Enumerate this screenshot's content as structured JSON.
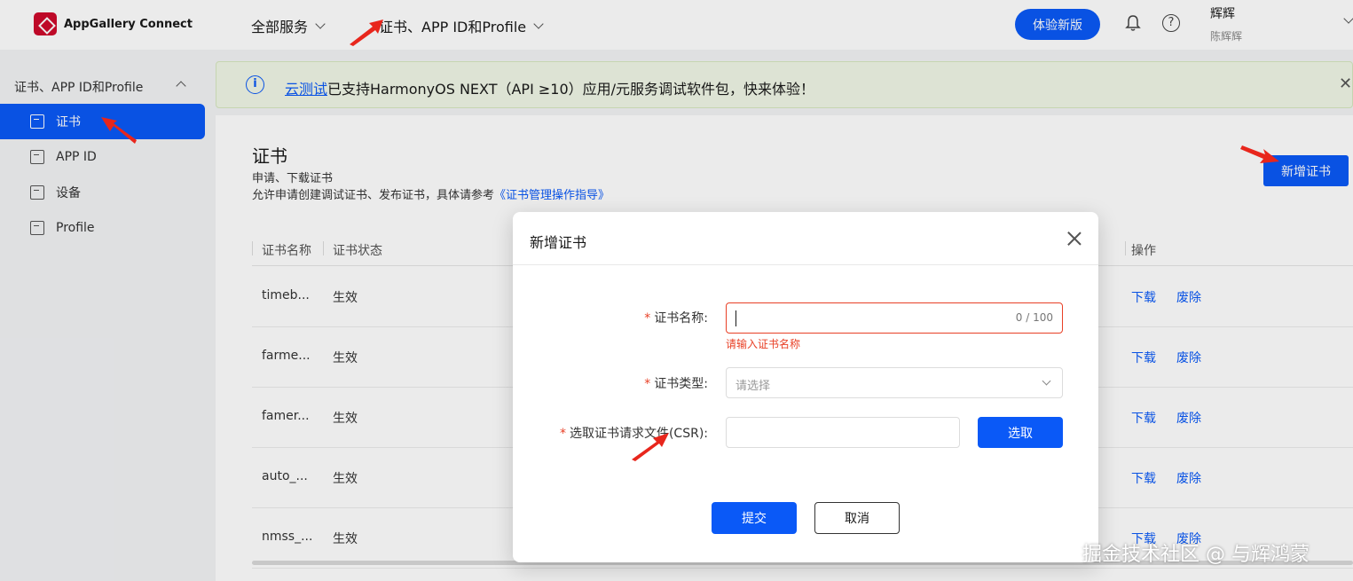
{
  "header": {
    "logo_text": "AppGallery Connect",
    "nav": [
      "全部服务",
      "证书、APP ID和Profile"
    ],
    "try_new_button": "体验新版",
    "user_name": "辉辉",
    "user_sub": "陈辉辉"
  },
  "sidebar": {
    "section_title": "证书、APP ID和Profile",
    "items": [
      {
        "label": "证书",
        "active": true
      },
      {
        "label": "APP ID",
        "active": false
      },
      {
        "label": "设备",
        "active": false
      },
      {
        "label": "Profile",
        "active": false
      }
    ]
  },
  "banner": {
    "link": "云测试",
    "text": "已支持HarmonyOS NEXT（API ≥10）应用/元服务调试软件包，快来体验！",
    "close": "✕"
  },
  "page": {
    "title": "证书",
    "subtitle": "申请、下载证书",
    "desc_prefix": "允许申请创建调试证书、发布证书，具体请参考",
    "desc_link": "《证书管理操作指导》",
    "add_button": "新增证书"
  },
  "table": {
    "headers": {
      "name": "证书名称",
      "status": "证书状态",
      "actions": "操作"
    },
    "rows": [
      {
        "name": "timeb...",
        "status": "生效",
        "download": "下载",
        "revoke": "废除"
      },
      {
        "name": "farme...",
        "status": "生效",
        "download": "下载",
        "revoke": "废除"
      },
      {
        "name": "famer...",
        "status": "生效",
        "download": "下载",
        "revoke": "废除"
      },
      {
        "name": "auto_...",
        "status": "生效",
        "download": "下载",
        "revoke": "废除"
      },
      {
        "name": "nmss_...",
        "status": "生效",
        "download": "下载",
        "revoke": "废除"
      }
    ]
  },
  "modal": {
    "title": "新增证书",
    "fields": {
      "name_label": "证书名称:",
      "name_value": "",
      "name_counter": "0 / 100",
      "name_error": "请输入证书名称",
      "type_label": "证书类型:",
      "type_placeholder": "请选择",
      "csr_label": "选取证书请求文件(CSR):",
      "pick_button": "选取"
    },
    "submit": "提交",
    "cancel": "取消"
  },
  "watermark": "掘金技术社区 @ 与辉鸿蒙",
  "colors": {
    "primary": "#0a59f7",
    "error": "#e84026",
    "banner_bg": "#f0f7e6",
    "arrow": "#e8261c"
  }
}
